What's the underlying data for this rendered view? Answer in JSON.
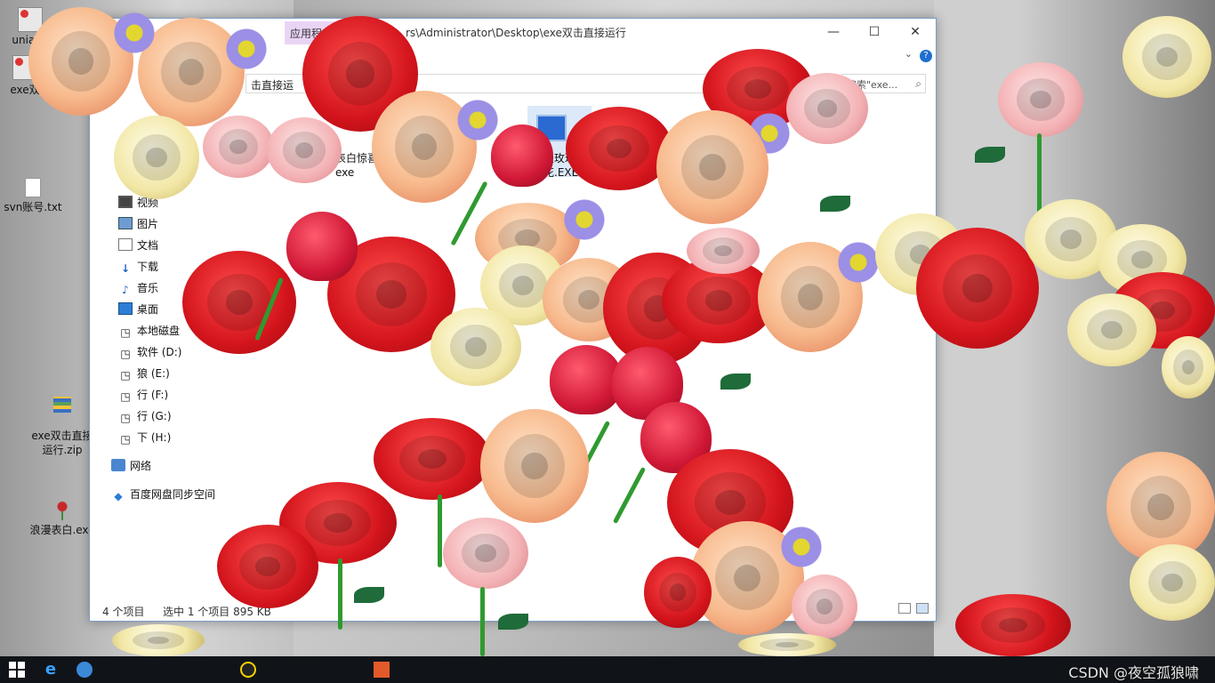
{
  "desktop": {
    "icons": [
      {
        "label": "uniapp",
        "icon": "app-icon"
      },
      {
        "label": "exe双",
        "icon": "app-icon"
      },
      {
        "label": "svn账号.txt",
        "icon": "text-file-icon"
      },
      {
        "label": "exe双击直接\n运行.zip",
        "icon": "zip-archive-icon"
      },
      {
        "label": "浪漫表白.exe",
        "icon": "rose-exe-icon"
      }
    ]
  },
  "window": {
    "ribbon_app_tab": "应用程序工具",
    "title_path": "rs\\Administrator\\Desktop\\exe双击直接运行",
    "controls": {
      "minimize": "—",
      "maximize": "☐",
      "close": "✕",
      "help": "?"
    },
    "address": "击直接运",
    "search_placeholder": "搜索\"exe...",
    "nav": [
      {
        "label": "视频",
        "icon": "video-icon"
      },
      {
        "label": "图片",
        "icon": "pictures-icon"
      },
      {
        "label": "文档",
        "icon": "documents-icon"
      },
      {
        "label": "下载",
        "icon": "download-icon"
      },
      {
        "label": "音乐",
        "icon": "music-icon"
      },
      {
        "label": "桌面",
        "icon": "desktop-icon"
      },
      {
        "label": "本地磁盘",
        "icon": "drive-icon"
      },
      {
        "label": "软件 (D:)",
        "icon": "drive-icon"
      },
      {
        "label": "狼 (E:)",
        "icon": "drive-icon"
      },
      {
        "label": "行 (F:)",
        "icon": "drive-icon"
      },
      {
        "label": "行 (G:)",
        "icon": "drive-icon"
      },
      {
        "label": "下 (H:)",
        "icon": "drive-icon"
      },
      {
        "label": "网络",
        "icon": "network-icon"
      },
      {
        "label": "百度网盘同步空间",
        "icon": "baidu-netdisk-icon"
      }
    ],
    "files": [
      {
        "line1": "表白惊喜",
        "line2": "exe"
      },
      {
        "line1": "漫玫瑰",
        "line2": "花.EXE"
      }
    ],
    "status": {
      "count": "4 个项目",
      "selection": "选中 1 个项目  895 KB"
    }
  },
  "taskbar": {
    "watermark": "CSDN @夜空孤狼啸"
  }
}
